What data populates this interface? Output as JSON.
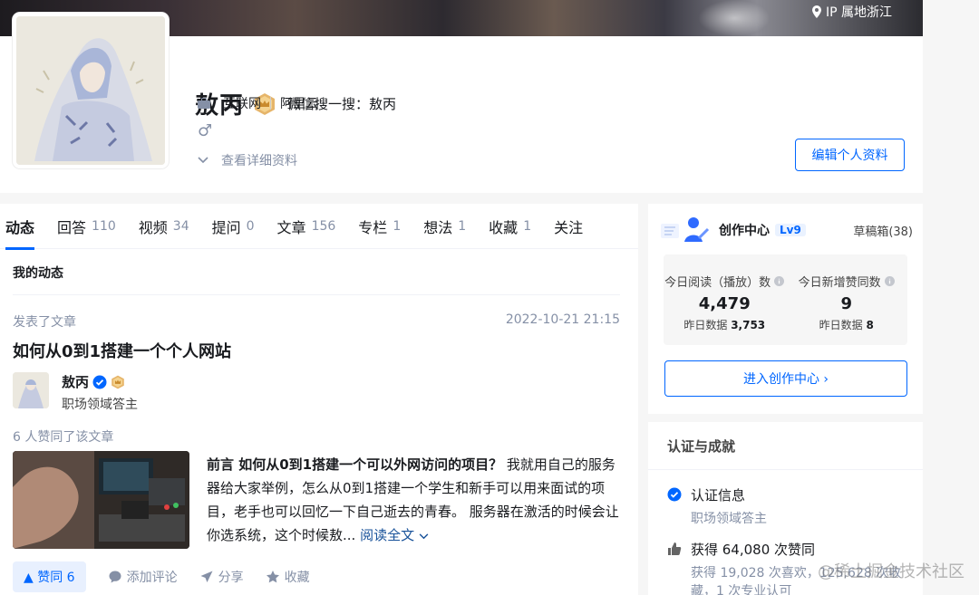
{
  "cover": {
    "ip_label": "IP 属地浙江"
  },
  "profile": {
    "name": "敖丙",
    "wechat": "微信搜一搜：敖丙",
    "industry": "互联网",
    "company": "阿里云",
    "gender_symbol": "♂",
    "detail_link": "查看详细资料",
    "edit_button": "编辑个人资料"
  },
  "tabs": [
    {
      "label": "动态",
      "count": ""
    },
    {
      "label": "回答",
      "count": "110"
    },
    {
      "label": "视频",
      "count": "34"
    },
    {
      "label": "提问",
      "count": "0"
    },
    {
      "label": "文章",
      "count": "156"
    },
    {
      "label": "专栏",
      "count": "1"
    },
    {
      "label": "想法",
      "count": "1"
    },
    {
      "label": "收藏",
      "count": "1"
    },
    {
      "label": "关注",
      "count": ""
    }
  ],
  "feed": {
    "section_title": "我的动态",
    "action": "发表了文章",
    "time": "2022-10-21 21:15",
    "title": "如何从0到1搭建一个个人网站",
    "author_name": "敖丙",
    "author_desc": "职场领域答主",
    "voters": "6 人赞同了该文章",
    "excerpt_bold": "前言 如何从0到1搭建一个可以外网访问的项目？",
    "excerpt_text": " 我就用自己的服务器给大家举例，怎么从0到1搭建一个学生和新手可以用来面试的项目，老手也可以回忆一下自己逝去的青春。 服务器在激活的时候会让你选系统，这个时候敖... ",
    "read_more": "阅读全文",
    "vote_label": "▲ 赞同 6",
    "comment": "添加评论",
    "share": "分享",
    "collect": "收藏"
  },
  "creator": {
    "title": "创作中心",
    "level": "Lv9",
    "drafts": "草稿箱(38)",
    "read_label": "今日阅读（播放）数",
    "read_value": "4,479",
    "read_yesterday_label": "昨日数据",
    "read_yesterday": "3,753",
    "vote_label": "今日新增赞同数",
    "vote_value": "9",
    "vote_yesterday_label": "昨日数据",
    "vote_yesterday": "8",
    "enter_button": "进入创作中心 ›"
  },
  "achievements": {
    "title": "认证与成就",
    "cert_label": "认证信息",
    "cert_desc": "职场领域答主",
    "votes_label": "获得 64,080 次赞同",
    "votes_desc": "获得 19,028 次喜欢，125,628 次收藏，1 次专业认可"
  },
  "watermark": "@稀土掘金技术社区",
  "colors": {
    "accent": "#0066ff",
    "muted": "#8590a6",
    "link": "#175199"
  }
}
